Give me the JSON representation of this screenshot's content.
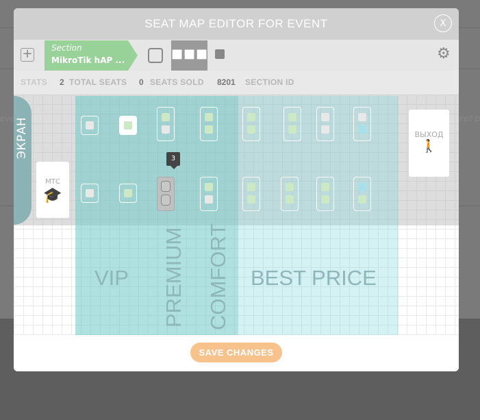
{
  "background": {
    "left_text": "eve",
    "right_text": "ket p"
  },
  "modal": {
    "title": "SEAT MAP EDITOR FOR EVENT",
    "close_label": "X"
  },
  "toolbar": {
    "add_label": "+",
    "section_label": "Section",
    "section_name": "MikroTik hAP ...",
    "dots_label": "■■■",
    "settings_icon": "gear-icon"
  },
  "stats": {
    "label": "STATS",
    "total_seats_value": "2",
    "total_seats_label": "TOTAL SEATS",
    "seats_sold_value": "0",
    "seats_sold_label": "SEATS SOLD",
    "section_id_value": "8201",
    "section_id_label": "SECTION ID"
  },
  "map": {
    "screen_label": "ЭКРАН",
    "mtc_label": "МТС",
    "exit_label": "ВЫХОД",
    "tooltip_value": "3",
    "zones": {
      "vip": "VIP",
      "premium": "PREMIUM",
      "comfort": "COMFORT",
      "best_price": "BEST PRICE"
    }
  },
  "footer": {
    "save_label": "SAVE CHANGES"
  },
  "colors": {
    "accent_green": "#99d298",
    "save_orange": "#f7c28c",
    "zone_teal": "#6ec8c8"
  }
}
